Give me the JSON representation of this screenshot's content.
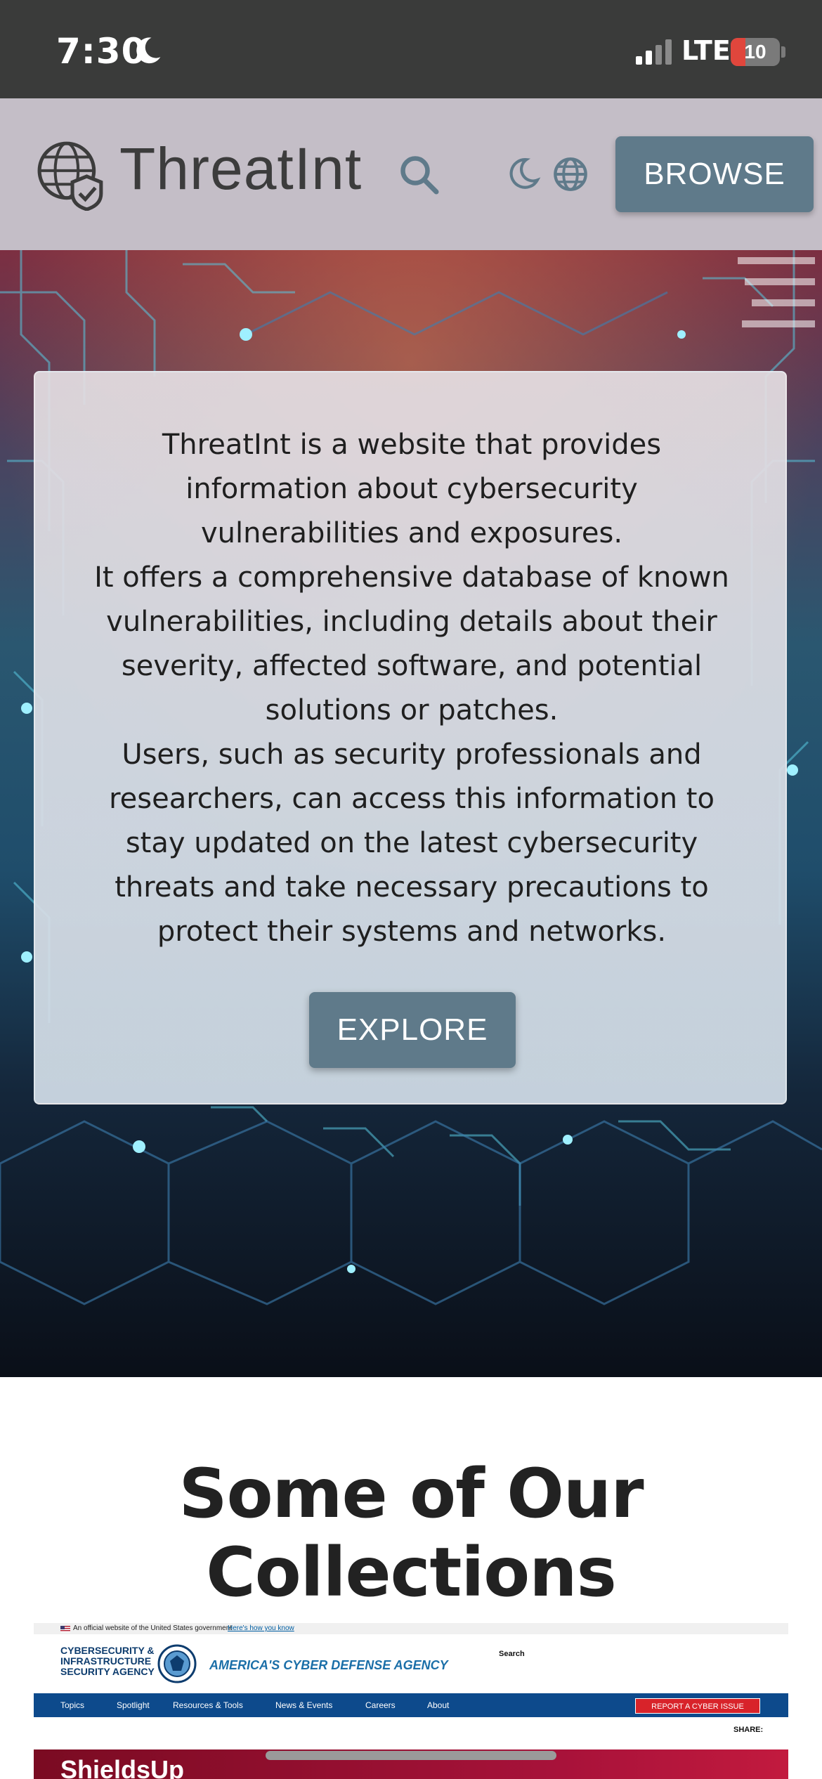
{
  "status_bar": {
    "time": "7:30",
    "network": "LTE",
    "battery": "10",
    "battery_level": 0.1
  },
  "header": {
    "brand": "ThreatInt",
    "browse_label": "BROWSE"
  },
  "hero": {
    "paragraphs": [
      "ThreatInt is a website that provides information about cybersecurity vulnerabilities and exposures.",
      "It offers a comprehensive database of known vulnerabilities, including details about their severity, affected software, and potential solutions or patches.",
      "Users, such as security professionals and researchers, can access this information to stay updated on the latest cybersecurity threats and take necessary precautions to protect their systems and networks."
    ],
    "explore_label": "EXPLORE"
  },
  "collections": {
    "heading": "Some of Our Collections",
    "preview": {
      "gov_banner": "An official website of the United States government",
      "gov_banner_link": "Here's how you know",
      "agency_name": "CYBERSECURITY & INFRASTRUCTURE SECURITY AGENCY",
      "tagline": "AMERICA'S CYBER DEFENSE AGENCY",
      "search_label": "Search",
      "nav": [
        "Topics",
        "Spotlight",
        "Resources & Tools",
        "News & Events",
        "Careers",
        "About"
      ],
      "report_label": "REPORT A CYBER ISSUE",
      "share_label": "SHARE:",
      "hero_title": "ShieldsUp"
    }
  },
  "colors": {
    "accent": "#5f7a8a",
    "header_bg": "#c4bec7",
    "status_bar_bg": "#3a3b3a"
  }
}
